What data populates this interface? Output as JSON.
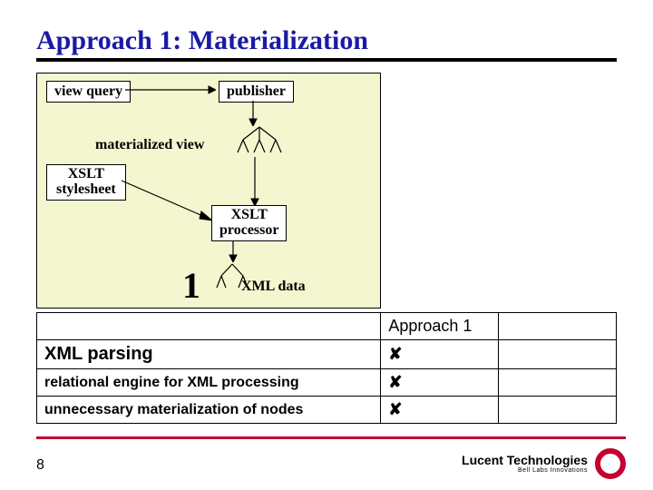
{
  "title": "Approach 1: Materialization",
  "diagram": {
    "view_query": "view query",
    "publisher": "publisher",
    "materialized_view": "materialized view",
    "xslt_stylesheet": "XSLT\nstylesheet",
    "xslt_processor": "XSLT\nprocessor",
    "xml_data": "XML data",
    "step_number": "1"
  },
  "table": {
    "header_approach": "Approach 1",
    "row1": "XML parsing",
    "row2": "relational engine for XML processing",
    "row3": "unnecessary materialization of nodes",
    "mark": "✘"
  },
  "footer": {
    "page": "8",
    "brand": "Lucent Technologies",
    "tag": "Bell Labs Innovations"
  }
}
